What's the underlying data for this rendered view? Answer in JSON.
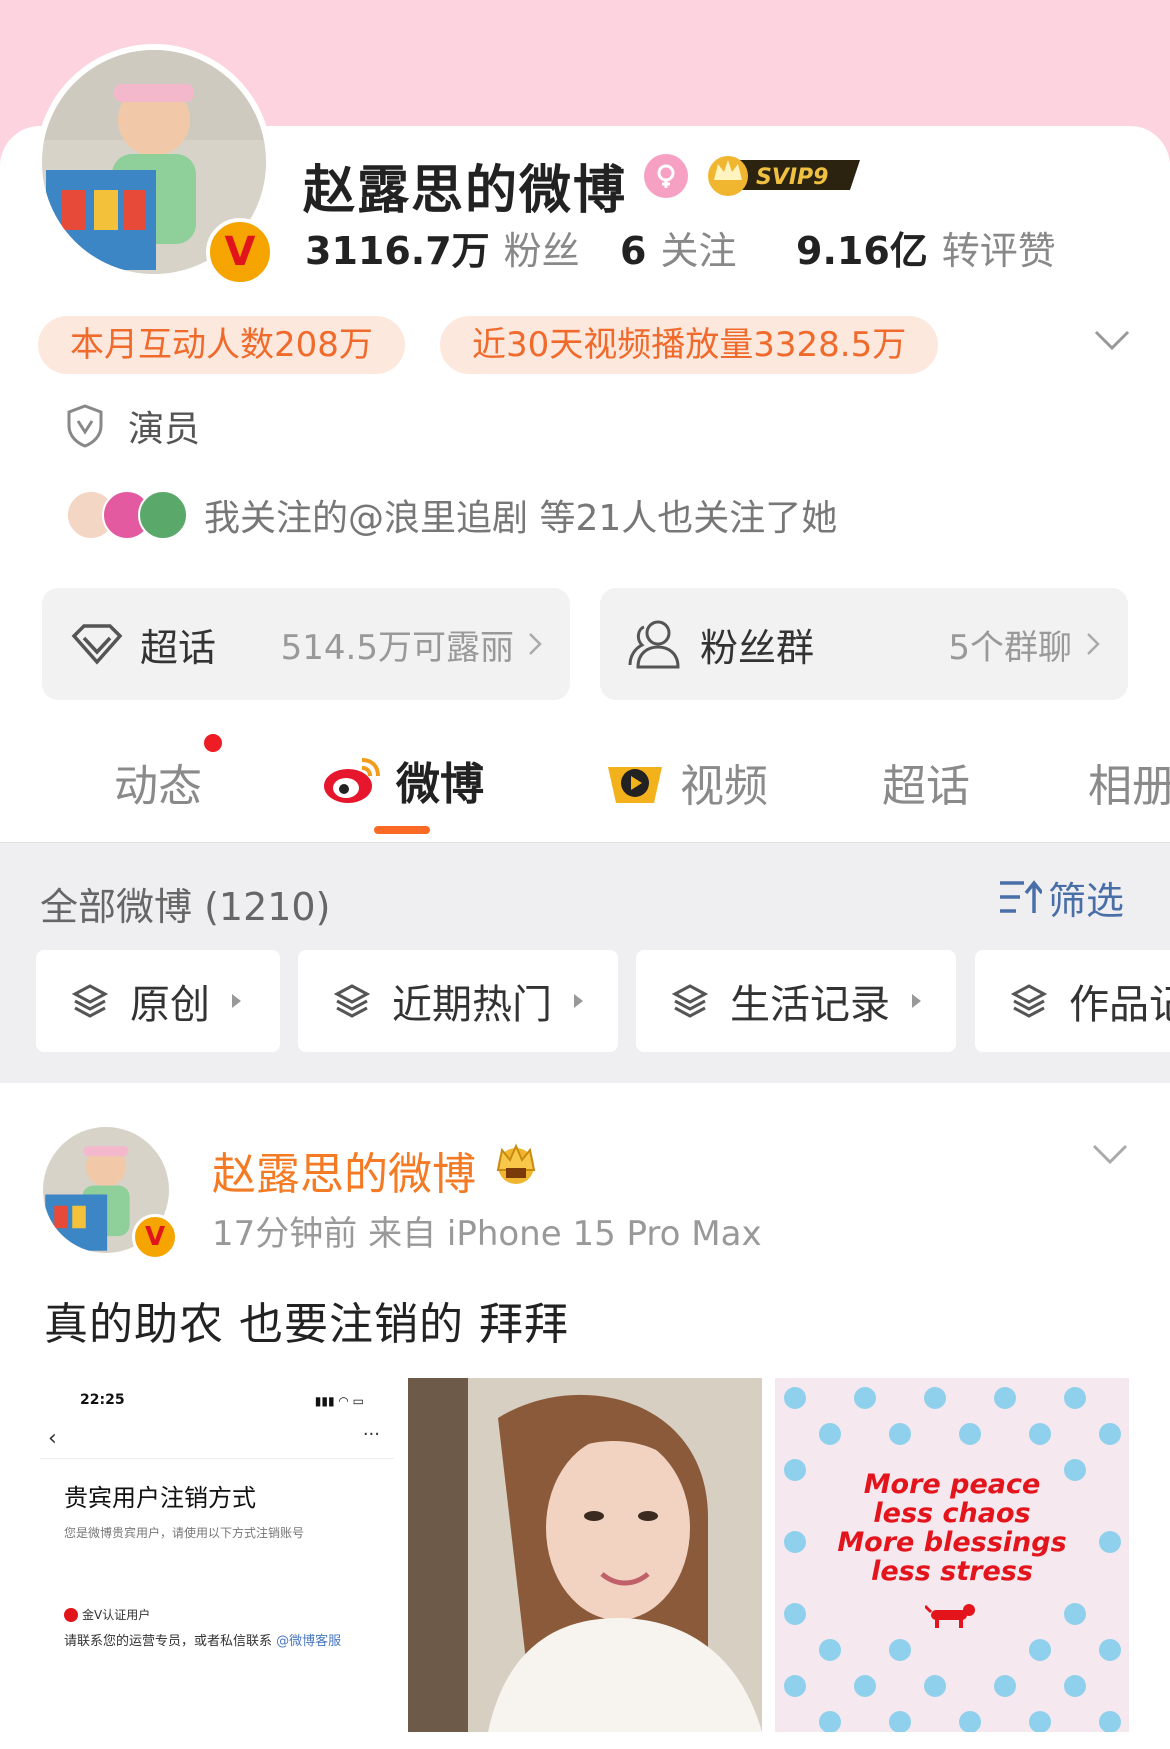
{
  "profile": {
    "name": "赵露思的微博",
    "svip_label": "SVIP9",
    "stats": [
      {
        "value": "3116.7万",
        "label": "粉丝"
      },
      {
        "value": "6",
        "label": "关注"
      },
      {
        "value": "9.16亿",
        "label": "转评赞"
      }
    ],
    "pills": [
      "本月互动人数208万",
      "近30天视频播放量3328.5万"
    ],
    "certification": "演员",
    "mutual_followers": "我关注的@浪里追剧 等21人也关注了她"
  },
  "boxes": {
    "super_topic": {
      "title": "超话",
      "detail": "514.5万可露丽"
    },
    "fan_group": {
      "title": "粉丝群",
      "detail": "5个群聊"
    }
  },
  "tabs": [
    "动态",
    "微博",
    "视频",
    "超话",
    "相册"
  ],
  "feed": {
    "count_label": "全部微博 (1210)",
    "filter_label": "筛选",
    "chips": [
      "原创",
      "近期热门",
      "生活记录",
      "作品记录"
    ]
  },
  "post": {
    "author": "赵露思的微博",
    "meta": "17分钟前  来自 iPhone 15 Pro Max",
    "text": "真的助农 也要注销的 拜拜",
    "screenshot": {
      "time": "22:25",
      "title": "贵宾用户注销方式",
      "subtitle": "您是微博贵宾用户，请使用以下方式注销账号",
      "gold_label": "金V认证用户",
      "contact": "请联系您的运营专员，或者私信联系",
      "contact_link": "@微博客服"
    },
    "quote_lines": [
      "More peace",
      "less chaos",
      "More blessings",
      "less stress"
    ]
  },
  "colors": {
    "accent_orange": "#fa6a24",
    "pink_header": "#fdd3e0",
    "pill_bg": "#fde8de",
    "link_blue": "#4a6fa8"
  }
}
